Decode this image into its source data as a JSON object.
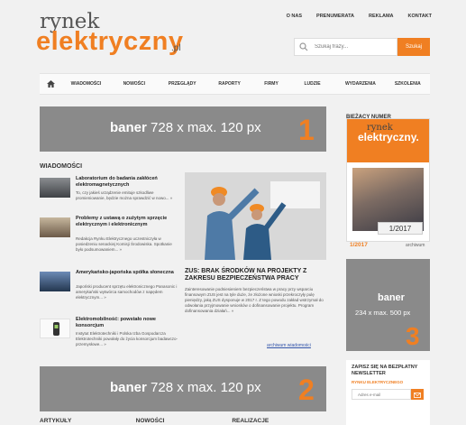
{
  "header": {
    "logo": {
      "line1": "rynek",
      "line2": "elektryczny",
      "tld": ".pl"
    },
    "top_links": [
      "O NAS",
      "PRENUMERATA",
      "REKLAMA",
      "KONTAKT"
    ],
    "search": {
      "placeholder": "Szukaj frazy...",
      "button": "Szukaj"
    }
  },
  "nav": {
    "items": [
      "WIADOMOŚCI",
      "NOWOŚCI",
      "PRZEGLĄDY",
      "RAPORTY",
      "FIRMY",
      "LUDZIE",
      "WYDARZENIA",
      "SZKOLENIA"
    ]
  },
  "banners": [
    {
      "word": "baner",
      "size": "728 x max. 120 px",
      "number": "1"
    },
    {
      "word": "baner",
      "size": "728 x max. 120 px",
      "number": "2"
    },
    {
      "word": "baner",
      "size": "234 x max. 500 px",
      "number": "3"
    }
  ],
  "sidebar": {
    "current_issue_heading": "BIEŻĄCY NUMER",
    "cover_title_1": "rynek",
    "cover_title_2": "elektryczny.",
    "cover_issue": "1/2017",
    "issue_label": "1/2017",
    "archive_link": "archiwum",
    "newsletter": {
      "heading": "ZAPISZ SIĘ NA BEZPŁATNY NEWSLETTER",
      "subheading": "RYNKU ELEKTRYCZNEGO",
      "placeholder": "Adres e-mail"
    }
  },
  "news": {
    "section_title": "WIADOMOŚCI",
    "items": [
      {
        "title": "Laboratorium do badania zakłóceń elektromagnetycznych",
        "desc": "To, czy jakieś urządzenie emituje szkodliwe promieniowanie, będzie można sprawdzić w nowo... »"
      },
      {
        "title": "Problemy z ustawą o zużytym sprzęcie elektrycznym i elektronicznym",
        "desc": "Redakcja Rynku Elektrycznego uczestniczyła w posiedzeniu senackiej Komisji Środowiska. Spotkanie było podsumowaniem... »"
      },
      {
        "title": "Amerykańsko-japońska spółka słoneczna",
        "desc": "Japoński producent sprzętu elektronicznego Panasonic i amerykański wytwórca samochodów z napędem elektrycznym... »"
      },
      {
        "title": "Elektromobilność: powstało nowe konsorcjum",
        "desc": "Instytut Elektrotechniki i Polska Izba Gospodarcza Elektrotechniki powołały do życia konsorcjum badawczo-przemysłowe... »"
      }
    ],
    "featured": {
      "title": "ZUS: BRAK ŚRODKÓW NA PROJEKTY Z ZAKRESU BEZPIECZEŃSTWA PRACY",
      "desc": "Zainteresowanie podniesieniem bezpieczeństwa w pracy przy wsparciu finansowym ZUS jest na tyle duże, że złożone wnioski przekroczyły pulę pieniędzy, jaką ZUS dysponuje w 2017 r. Z tego powodu zakład wstrzymał do odwołania przyjmowanie wniosków o dofinansowanie projektu. Program dofinansowania działań... »",
      "archive_link": "archiwum wiadomości"
    }
  },
  "bottom_tabs": [
    "ARTYKUŁY",
    "NOWOŚCI",
    "REALIZACJE"
  ],
  "colors": {
    "accent": "#f07f22",
    "banner": "#8a8a8a"
  }
}
